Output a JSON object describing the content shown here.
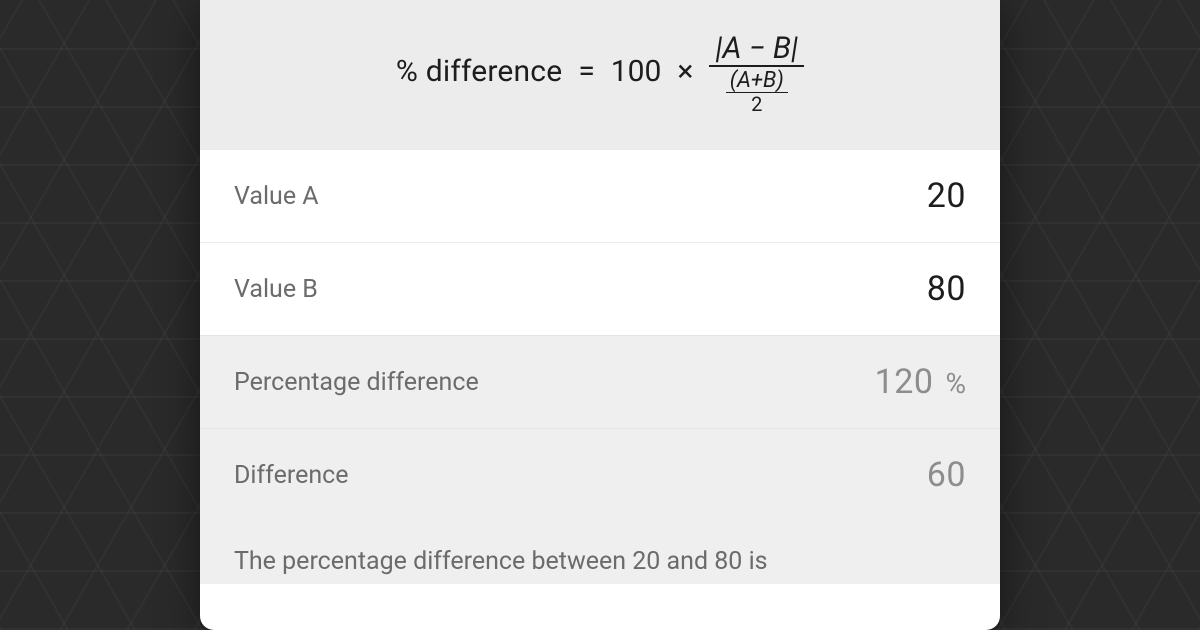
{
  "formula": {
    "lhs": "% difference",
    "equals": "=",
    "constant": "100",
    "times": "×",
    "numerator": "|A − B|",
    "denominator_top": "(A+B)",
    "denominator_bottom": "2"
  },
  "inputs": {
    "value_a": {
      "label": "Value A",
      "value": "20"
    },
    "value_b": {
      "label": "Value B",
      "value": "80"
    }
  },
  "results": {
    "percentage_difference": {
      "label": "Percentage difference",
      "value": "120",
      "unit": "%"
    },
    "difference": {
      "label": "Difference",
      "value": "60"
    }
  },
  "summary": "The percentage difference between 20 and 80 is"
}
